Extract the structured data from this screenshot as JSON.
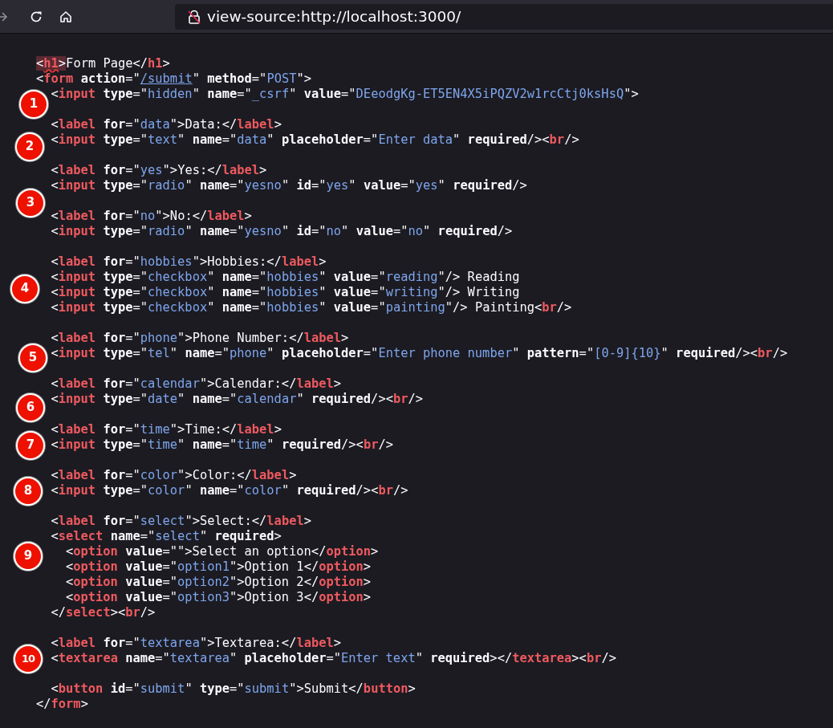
{
  "toolbar": {
    "buttons": [
      {
        "kind": "forward",
        "disabled": true
      },
      {
        "kind": "reload",
        "disabled": false
      },
      {
        "kind": "home",
        "disabled": false
      }
    ],
    "address": {
      "secure": false,
      "url": "view-source:http://localhost:3000/"
    }
  },
  "source": {
    "lines": [
      {
        "text": "<h1>Form Page</h1>",
        "error": true
      },
      {
        "text": "<form action=\"/submit\" method=\"POST\">",
        "first_value_link": true,
        "children": [
          {
            "text": "<input type=\"hidden\" name=\"_csrf\" value=\"DEeodgKg-ET5EN4X5iPQZV2w1rcCtj0ksHsQ\">",
            "marker": "1"
          },
          {
            "text": "<label for=\"data\">Data:</label>",
            "blank_before": true
          },
          {
            "text": "<input type=\"text\" name=\"data\" placeholder=\"Enter data\" required/><br/>",
            "marker": "2"
          },
          {
            "text": "<label for=\"yes\">Yes:</label>",
            "blank_before": true
          },
          {
            "text": "<input type=\"radio\" name=\"yesno\" id=\"yes\" value=\"yes\" required/>",
            "marker": "3"
          },
          {
            "text": "<label for=\"no\">No:</label>",
            "blank_before": true
          },
          {
            "text": "<input type=\"radio\" name=\"yesno\" id=\"no\" value=\"no\" required/>"
          },
          {
            "text": "<label for=\"hobbies\">Hobbies:</label>",
            "blank_before": true
          },
          {
            "text": "<input type=\"checkbox\" name=\"hobbies\" value=\"reading\"/> Reading"
          },
          {
            "text": "<input type=\"checkbox\" name=\"hobbies\" value=\"writing\"/> Writing",
            "marker": "4"
          },
          {
            "text": "<input type=\"checkbox\" name=\"hobbies\" value=\"painting\"/> Painting<br/>"
          },
          {
            "text": "<label for=\"phone\">Phone Number:</label>",
            "blank_before": true
          },
          {
            "text": "<input type=\"tel\" name=\"phone\" placeholder=\"Enter phone number\" pattern=\"[0-9]{10}\" required/><br/>",
            "marker": "5"
          },
          {
            "text": "<label for=\"calendar\">Calendar:</label>",
            "blank_before": true
          },
          {
            "text": "<input type=\"date\" name=\"calendar\" required/><br/>",
            "marker": "6"
          },
          {
            "text": "<label for=\"time\">Time:</label>",
            "blank_before": true
          },
          {
            "text": "<input type=\"time\" name=\"time\" required/><br/>",
            "marker": "7"
          },
          {
            "text": "<label for=\"color\">Color:</label>",
            "blank_before": true
          },
          {
            "text": "<input type=\"color\" name=\"color\" required/><br/>",
            "marker": "8"
          },
          {
            "text": "<label for=\"select\">Select:</label>",
            "blank_before": true
          },
          {
            "text": "<select name=\"select\" required>",
            "children": [
              {
                "text": "<option value=\"\">Select an option</option>",
                "marker": "9"
              },
              {
                "text": "<option value=\"option1\">Option 1</option>"
              },
              {
                "text": "<option value=\"option2\">Option 2</option>"
              },
              {
                "text": "<option value=\"option3\">Option 3</option>"
              }
            ]
          },
          {
            "text": "</select><br/>"
          },
          {
            "text": "<label for=\"textarea\">Textarea:</label>",
            "blank_before": true
          },
          {
            "text": "<textarea name=\"textarea\" placeholder=\"Enter text\" required></textarea><br/>",
            "marker": "10"
          },
          {
            "text": "<button id=\"submit\" type=\"submit\">Submit</button>",
            "blank_before": true
          }
        ]
      },
      {
        "text": "</form>"
      }
    ]
  }
}
